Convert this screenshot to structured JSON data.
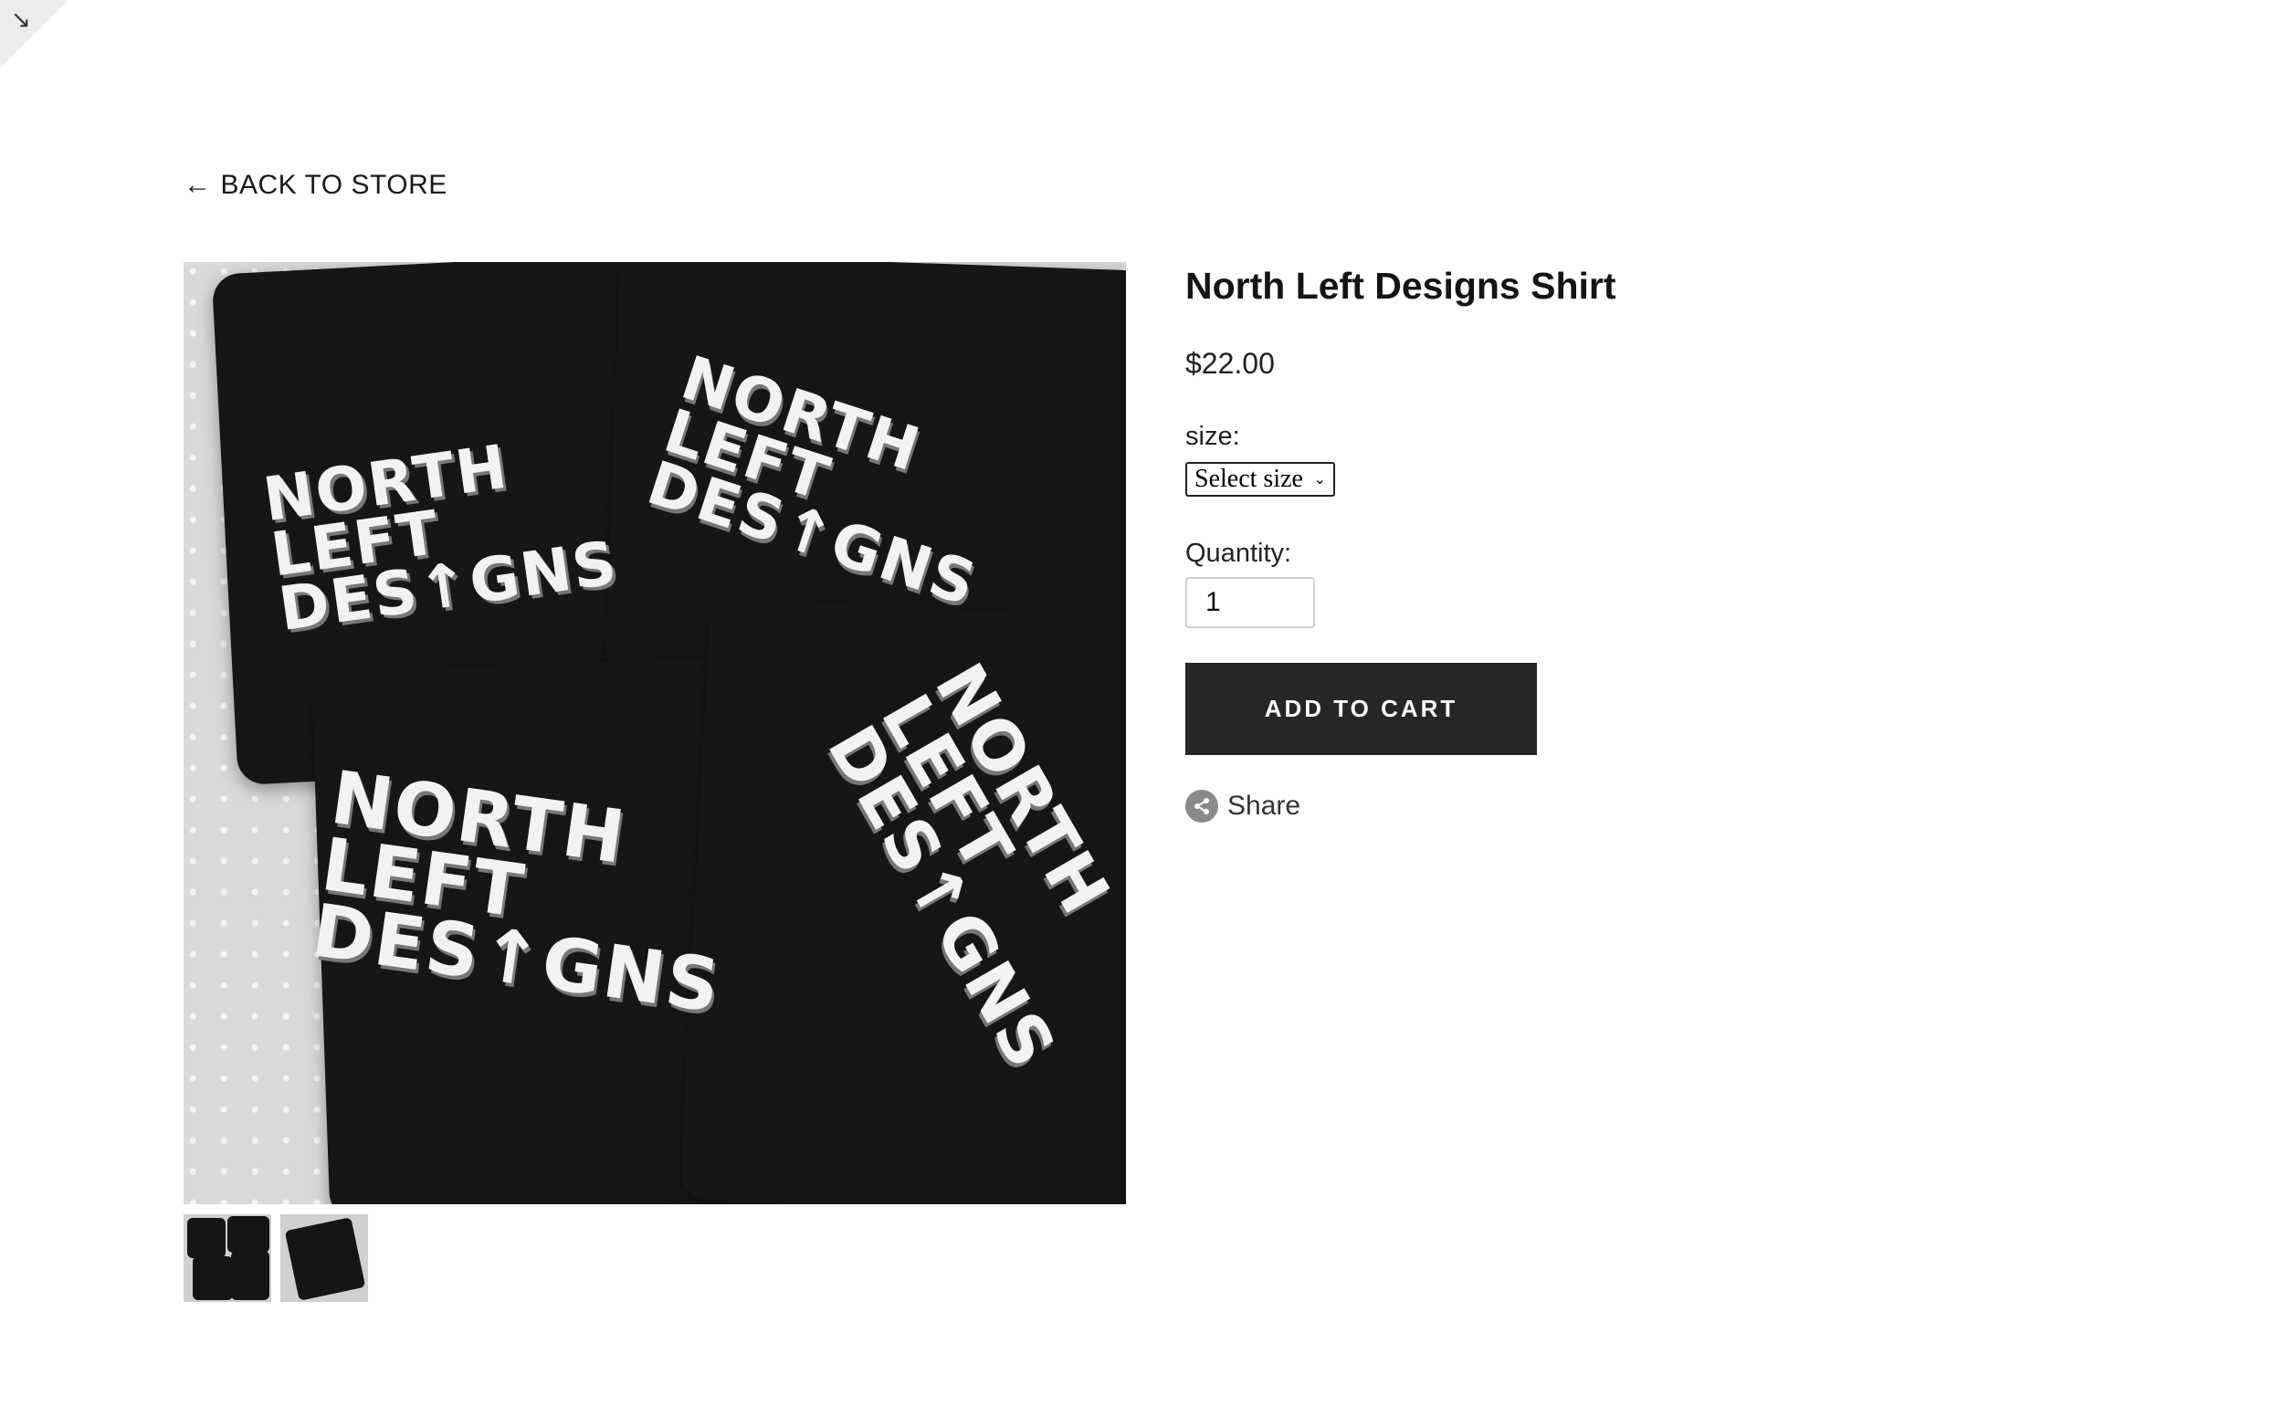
{
  "nav": {
    "back_label": "BACK TO STORE"
  },
  "product": {
    "title": "North Left Designs Shirt",
    "price": "$22.00",
    "shirt_print": "NORTH\nLEFT\nDES↑GNS"
  },
  "options": {
    "size_label": "size:",
    "size_selected": "Select size",
    "quantity_label": "Quantity:",
    "quantity_value": "1"
  },
  "actions": {
    "add_to_cart": "ADD TO CART",
    "share": "Share"
  },
  "colors": {
    "button_bg": "#262626",
    "shirt": "#161616"
  }
}
